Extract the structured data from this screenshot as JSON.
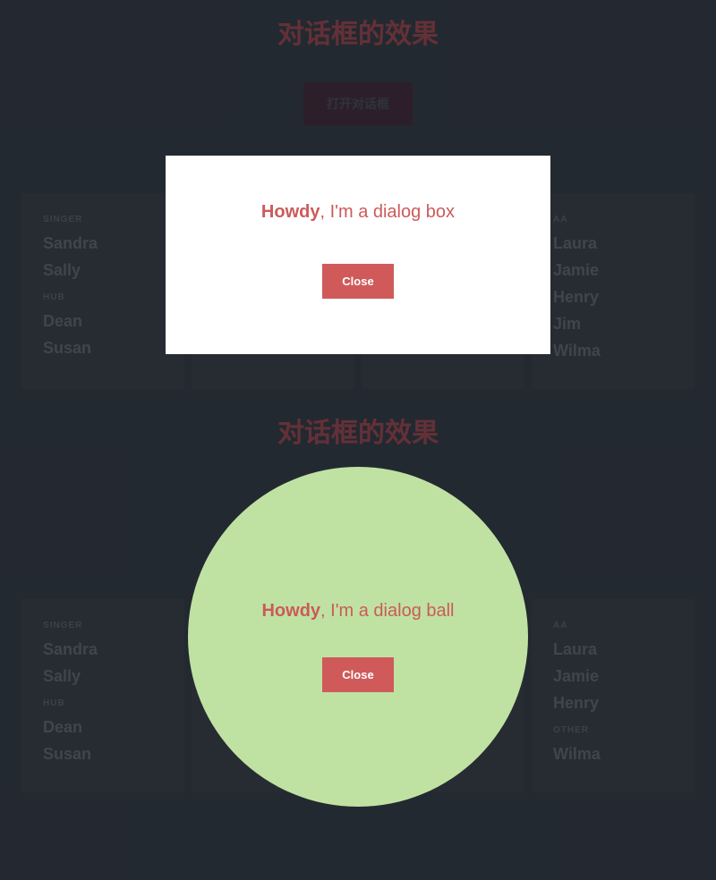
{
  "section1": {
    "title": "对话框的效果",
    "open_button": "打开对话框",
    "columns": [
      {
        "label1": "SINGER",
        "names1": [
          "Sandra",
          "Sally"
        ],
        "label2": "HUB",
        "names2": [
          "Dean",
          "Susan"
        ]
      },
      {
        "label1": "",
        "names1": [],
        "label2": "",
        "names2": []
      },
      {
        "label1": "",
        "names1": [],
        "label2": "",
        "names2": []
      },
      {
        "label1": "AA",
        "names1": [
          "Laura",
          "Jamie",
          "Henry",
          "Jim",
          "Wilma"
        ],
        "label2": "",
        "names2": []
      }
    ],
    "dialog": {
      "howdy": "Howdy",
      "rest": ", I'm a dialog box",
      "close": "Close"
    }
  },
  "section2": {
    "title": "对话框的效果",
    "columns": [
      {
        "label1": "SINGER",
        "names1": [
          "Sandra",
          "Sally"
        ],
        "label2": "HUB",
        "names2": [
          "Dean",
          "Susan"
        ]
      },
      {
        "label1": "",
        "names1": [],
        "label2": "",
        "names2": []
      },
      {
        "label1": "",
        "names1": [],
        "label2": "",
        "names2": []
      },
      {
        "label1": "AA",
        "names1": [
          "Laura",
          "Jamie",
          "Henry"
        ],
        "label2": "OTHER",
        "names2": [
          "Wilma"
        ]
      }
    ],
    "dialog": {
      "howdy": "Howdy",
      "rest": ", I'm a dialog ball",
      "close": "Close"
    }
  }
}
